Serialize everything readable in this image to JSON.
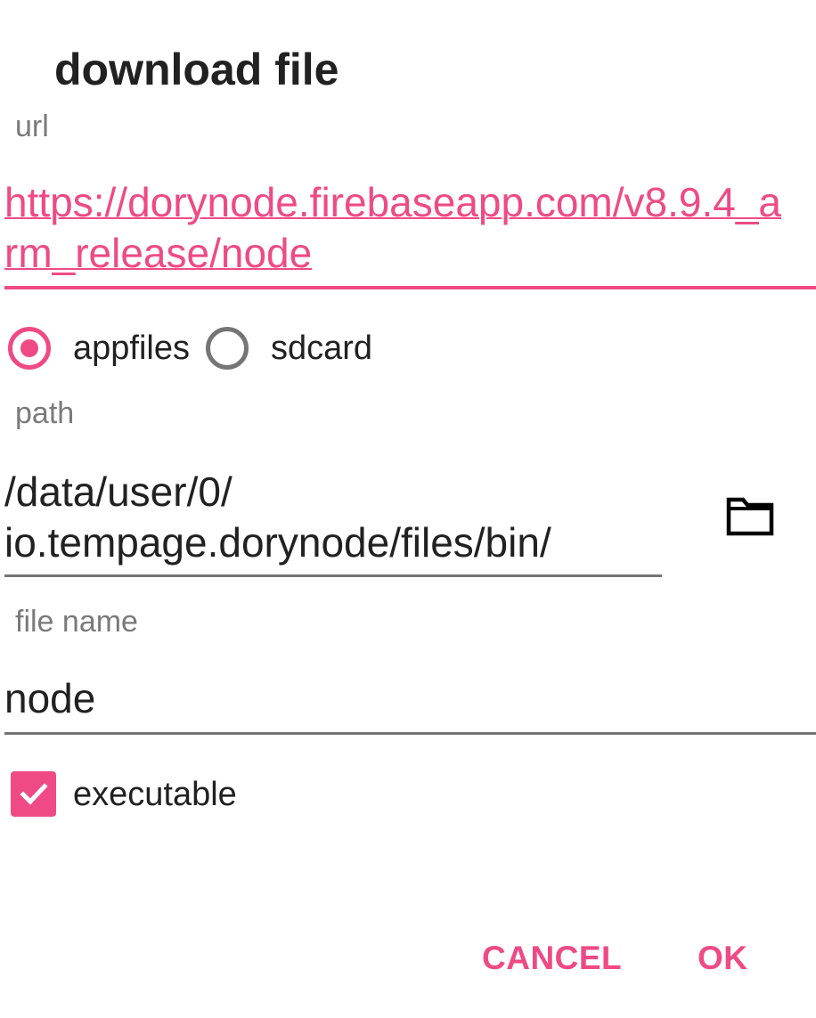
{
  "dialog": {
    "title": "download file"
  },
  "url_field": {
    "label": "url",
    "value": "https://dorynode.firebaseapp.com/v8.9.4_arm_release/node"
  },
  "storage_radio": {
    "options": [
      {
        "label": "appfiles",
        "checked": true
      },
      {
        "label": "sdcard",
        "checked": false
      }
    ]
  },
  "path_field": {
    "label": "path",
    "value": "/data/user/0/ io.tempage.dorynode/files/bin/",
    "browse_icon": "folder-icon"
  },
  "filename_field": {
    "label": "file name",
    "value": "node"
  },
  "executable_checkbox": {
    "label": "executable",
    "checked": true
  },
  "actions": {
    "cancel_label": "CANCEL",
    "ok_label": "OK"
  },
  "colors": {
    "accent": "#ef4a86",
    "text_primary": "#212121",
    "text_secondary": "#7a7a7a",
    "underline_inactive": "#757575"
  }
}
